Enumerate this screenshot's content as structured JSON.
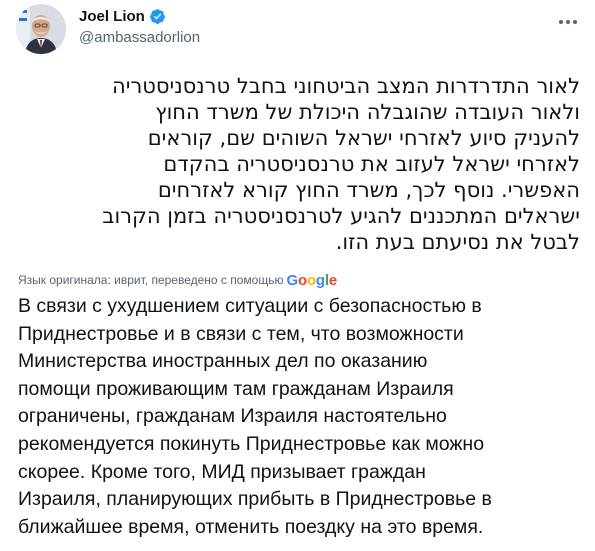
{
  "author": {
    "display_name": "Joel Lion",
    "handle": "@ambassadorlion",
    "verified_icon": "verified-badge-icon",
    "verified_color": "#1d9bf0",
    "avatar": "avatar-photo"
  },
  "more_icon": "more-options-icon",
  "tweet": {
    "original_text": "לאור התדרדרות המצב הביטחוני בחבל טרנסניסטריה\nולאור העובדה שהוגבלה היכולת של משרד החוץ\nלהעניק סיוע לאזרחי ישראל השוהים שם, קוראים\nלאזרחי ישראל לעזוב את טרנסניסטריה בהקדם\nהאפשרי. נוסף לכך, משרד החוץ קורא לאזרחים\nישראלים המתכננים להגיע לטרנסניסטריה בזמן הקרוב\nלבטל את נסיעתם בעת הזו.",
    "translation_note": "Язык оригинала: иврит, переведено с помощью",
    "translation_provider": [
      "G",
      "o",
      "o",
      "g",
      "l",
      "e"
    ],
    "translated_text": "В связи с ухудшением ситуации с безопасностью в\nПриднестровье и в связи с тем, что возможности\nМинистерства иностранных дел по оказанию\nпомощи проживающим там гражданам Израиля\nограничены, гражданам Израиля настоятельно\nрекомендуется покинуть Приднестровье как можно\nскорее. Кроме того, МИД призывает граждан\nИзраиля, планирующих прибыть в Приднестровье в\nближайшее время, отменить поездку на это время."
  },
  "colors": {
    "text_primary": "#0f1419",
    "text_secondary": "#536471",
    "google_blue": "#4285f4",
    "google_red": "#ea4335",
    "google_yellow": "#fbbc05",
    "google_green": "#34a853"
  }
}
